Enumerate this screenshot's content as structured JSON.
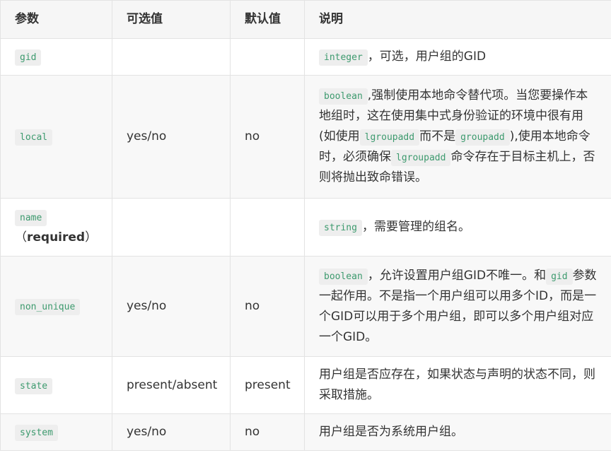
{
  "header": {
    "col_param": "参数",
    "col_options": "可选值",
    "col_default": "默认值",
    "col_desc": "说明"
  },
  "rows": [
    {
      "param": "gid",
      "options": "",
      "default": "",
      "desc": {
        "code1": "integer",
        "text1": "，可选，用户组的GID"
      }
    },
    {
      "param": "local",
      "options": "yes/no",
      "default": "no",
      "desc": {
        "code1": "boolean",
        "text1": ",强制使用本地命令替代项。当您要操作本地组时，这在使用集中式身份验证的环境中很有用(如使用",
        "code2": "lgroupadd",
        "text2": "而不是",
        "code3": "groupadd",
        "text3": "),使用本地命令时，必须确保",
        "code4": "lgroupadd",
        "text4": "命令存在于目标主机上，否则将抛出致命错误。"
      }
    },
    {
      "param": "name",
      "param_note_open": "（",
      "param_note": "required",
      "param_note_close": "）",
      "options": "",
      "default": "",
      "desc": {
        "code1": "string",
        "text1": "，需要管理的组名。"
      }
    },
    {
      "param": "non_unique",
      "options": "yes/no",
      "default": "no",
      "desc": {
        "code1": "boolean",
        "text1": "，允许设置用户组GID不唯一。和",
        "code2": "gid",
        "text2": "参数一起作用。不是指一个用户组可以用多个ID，而是一个GID可以用于多个用户组，即可以多个用户组对应一个GID。"
      }
    },
    {
      "param": "state",
      "options": "present/absent",
      "default": "present",
      "desc": {
        "text1": "用户组是否应存在，如果状态与声明的状态不同，则采取措施。"
      }
    },
    {
      "param": "system",
      "options": "yes/no",
      "default": "no",
      "desc": {
        "text1": "用户组是否为系统用户组。"
      }
    }
  ],
  "colors": {
    "code_text": "#3d9a6e",
    "code_bg": "#eeeeee",
    "border": "#e3e3e3",
    "header_bg": "#f6f6f6",
    "stripe_bg": "#f8f8f8"
  }
}
